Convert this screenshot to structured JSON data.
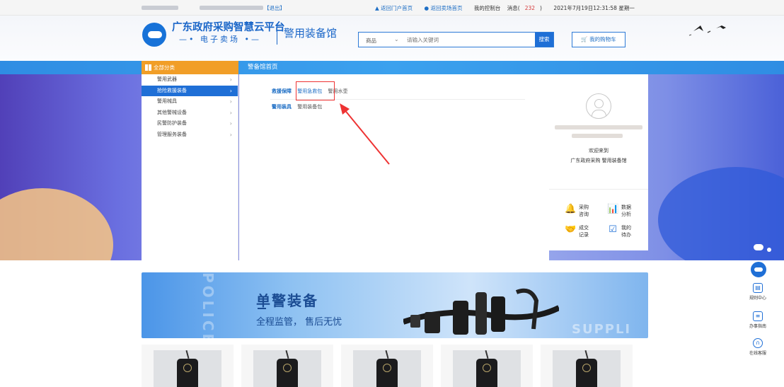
{
  "topbar": {
    "logout": "【退出】",
    "back_portal": "返回门户首页",
    "back_mall": "返回卖场首页",
    "console": "我的控制台",
    "messages_label": "消息(",
    "messages_count": "232",
    "messages_close": ")",
    "datetime": "2021年7月19日12:31:58 星期一"
  },
  "header": {
    "brand_main": "广东政府采购智慧云平台",
    "brand_sub": "电子卖场",
    "brand_hall": "警用装备馆",
    "search_category": "商品",
    "search_placeholder": "请输入关键词",
    "search_button": "搜索",
    "cart": "我的购物车"
  },
  "nav": {
    "all_categories": "全部分类",
    "home_tab": "警备馆首页"
  },
  "sidebar": {
    "items": [
      {
        "label": "警用武器"
      },
      {
        "label": "抢险救援装备"
      },
      {
        "label": "警用械具"
      },
      {
        "label": "其他警械设备"
      },
      {
        "label": "民警防护装备"
      },
      {
        "label": "管理服务装备"
      }
    ],
    "active_index": 1
  },
  "category_panel": {
    "row1_title": "救援保障",
    "row1_links": [
      "警用急救包",
      "警用水壶"
    ],
    "row2_title": "警用装具",
    "row2_links": [
      "警用装备包"
    ],
    "highlighted_link": "警用急救包"
  },
  "profile": {
    "welcome_1": "欢迎来到",
    "welcome_2": "广东政府采购 警用装备馆"
  },
  "quick_links": [
    {
      "icon": "bell-icon",
      "line1": "采购",
      "line2": "咨询"
    },
    {
      "icon": "chart-icon",
      "line1": "数据",
      "line2": "分析"
    },
    {
      "icon": "handshake-icon",
      "line1": "成交",
      "line2": "记录"
    },
    {
      "icon": "todo-icon",
      "line1": "我的",
      "line2": "待办"
    }
  ],
  "float_bar": {
    "rules": "规则中心",
    "guide": "办事指南",
    "service": "在线客服"
  },
  "promo": {
    "title": "单警装备",
    "subtitle": "全程监管， 售后无忧",
    "bg_left": "POLICE",
    "bg_right": "SUPPLI"
  },
  "colors": {
    "primary": "#1f6fd6",
    "orange": "#f19e27",
    "red": "#e33333"
  }
}
